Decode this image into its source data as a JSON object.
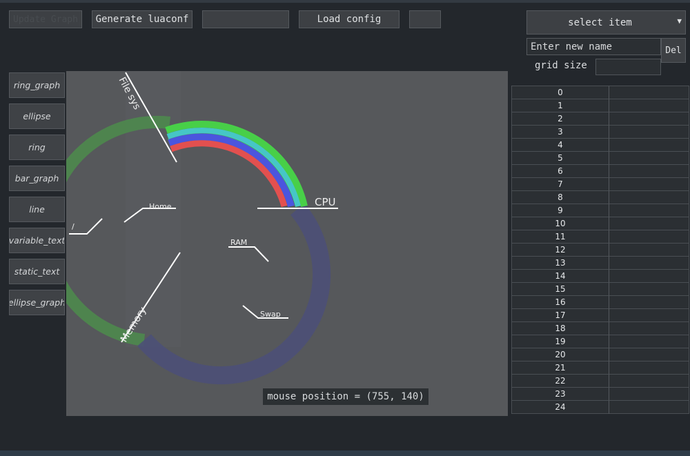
{
  "toolbar": {
    "btn1_label": "Update Graph",
    "generate_label": "Generate luaconf",
    "config_name_value": "",
    "load_label": "Load config",
    "small_button_label": ""
  },
  "right_panel": {
    "select_label": "select item",
    "select_arrow": "▼",
    "new_name_placeholder": "Enter new name",
    "del_label": "Del",
    "grid_size_label": "grid size",
    "grid_size_value": ""
  },
  "sidebar": {
    "items": [
      {
        "label": "ring_graph"
      },
      {
        "label": "ellipse"
      },
      {
        "label": "ring"
      },
      {
        "label": "bar_graph"
      },
      {
        "label": "line"
      },
      {
        "label": "variable_text"
      },
      {
        "label": "static_text"
      },
      {
        "label": "ellipse_graph"
      }
    ]
  },
  "canvas": {
    "labels": {
      "file_sys": "File sys",
      "cpu": "CPU",
      "home": "Home",
      "root": "/",
      "ram": "RAM",
      "swap": "Swap",
      "memory": "Memory"
    },
    "mouse_position": "mouse position = (755, 140)"
  },
  "grid": {
    "rows": [
      "0",
      "1",
      "2",
      "3",
      "4",
      "5",
      "6",
      "7",
      "8",
      "9",
      "10",
      "11",
      "12",
      "13",
      "14",
      "15",
      "16",
      "17",
      "18",
      "19",
      "20",
      "21",
      "22",
      "23",
      "24"
    ]
  },
  "colors": {
    "ring_red": "#e2504f",
    "ring_blue": "#4b55de",
    "ring_cyan": "#46c6c6",
    "ring_green": "#48cf48",
    "fs_ring": "#4c8c4c",
    "mem_ring": "#4d5077"
  }
}
